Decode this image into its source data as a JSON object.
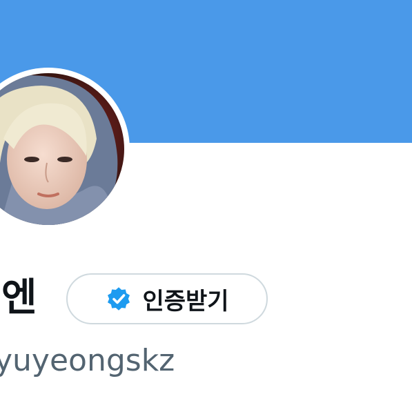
{
  "profile": {
    "display_name": "엔",
    "handle": "yuyeongskz",
    "verify_button_label": "인증받기"
  },
  "colors": {
    "banner": "#4a99e9",
    "verified_badge": "#1d9bf0",
    "handle_text": "#536471",
    "button_border": "#cfd9de"
  },
  "icons": {
    "verify": "verified-badge-icon"
  }
}
